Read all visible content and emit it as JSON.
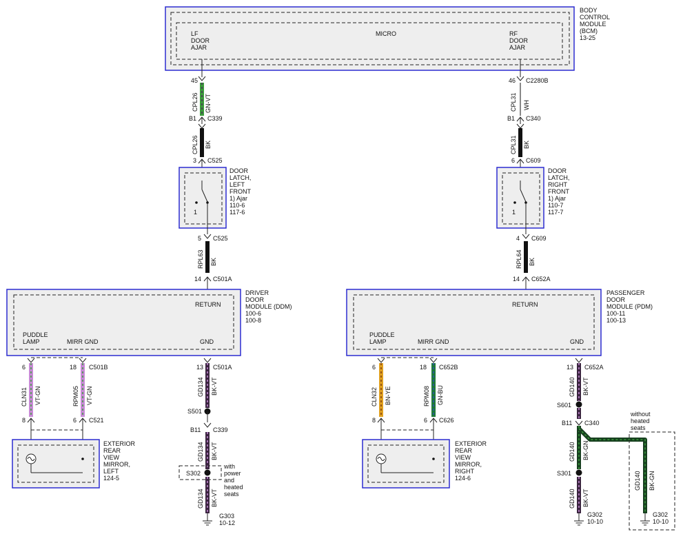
{
  "colors": {
    "box_border": "#2b2bd0",
    "GN-VT": "#3c9a3c",
    "VT-GN": "#c88bd6",
    "BK": "#111111",
    "WH": "#ffffff",
    "BK-VT": "#3b2540",
    "BN-YE": "#e0a020",
    "GN-BU": "#1f7a3a",
    "BK-GN": "#17401f"
  },
  "bcm": {
    "name_lines": [
      "BODY",
      "CONTROL",
      "MODULE",
      "(BCM)",
      "13-25"
    ],
    "micro": "MICRO",
    "lf_lines": [
      "LF",
      "DOOR",
      "AJAR"
    ],
    "rf_lines": [
      "RF",
      "DOOR",
      "AJAR"
    ]
  },
  "left": {
    "wire1": {
      "pin_top": "45",
      "circuit": "CPL26",
      "color": "GN-VT",
      "pin_bottom": "B1",
      "connector_bottom": "C339"
    },
    "wire2": {
      "circuit": "CPL26",
      "color": "BK",
      "pin_bottom": "3",
      "connector_bottom": "C525"
    },
    "latch": {
      "label_lines": [
        "DOOR",
        "LATCH,",
        "LEFT",
        "FRONT",
        "1) Ajar",
        "110-6",
        "117-6"
      ],
      "switch_num": "1"
    },
    "wire3": {
      "pin_top": "5",
      "connector_top": "C525",
      "circuit": "RPL63",
      "color": "BK",
      "pin_bottom": "14",
      "connector_bottom": "C501A"
    },
    "module": {
      "label_lines": [
        "DRIVER",
        "DOOR",
        "MODULE (DDM)",
        "100-6",
        "100-8"
      ],
      "return": "RETURN",
      "puddle_lines": [
        "PUDDLE",
        "LAMP"
      ],
      "mirr_gnd": "MIRR GND",
      "gnd": "GND"
    },
    "puddle_wire": {
      "pin_top": "6",
      "circuit": "CLN31",
      "color": "VT-GN",
      "pin_bottom": "8"
    },
    "mirr_wire": {
      "pin_top": "18",
      "connector_top": "C501B",
      "circuit": "RPM05",
      "color": "VT-GN",
      "pin_bottom": "6",
      "connector_bottom": "C521"
    },
    "mirror": {
      "label_lines": [
        "EXTERIOR",
        "REAR",
        "VIEW",
        "MIRROR,",
        "LEFT",
        "124-5"
      ]
    },
    "gnd_wire1": {
      "pin_top": "13",
      "connector_top": "C501A",
      "circuit": "GD134",
      "color": "BK-VT"
    },
    "splice1": "S501",
    "gnd_wire2": {
      "pin_top": "B11",
      "connector_top": "C339",
      "circuit": "GD134",
      "color": "BK-VT"
    },
    "splice2": "S302",
    "splice2_note_lines": [
      "with",
      "power",
      "and",
      "heated",
      "seats"
    ],
    "gnd_wire3": {
      "circuit": "GD134",
      "color": "BK-VT"
    },
    "ground": {
      "id": "G303",
      "ref": "10-12"
    }
  },
  "right": {
    "wire1": {
      "pin_top": "46",
      "connector_top": "C2280B",
      "circuit": "CPL31",
      "color": "WH",
      "pin_bottom": "B1",
      "connector_bottom": "C340"
    },
    "wire2": {
      "circuit": "CPL31",
      "color": "BK",
      "pin_bottom": "6",
      "connector_bottom": "C609"
    },
    "latch": {
      "label_lines": [
        "DOOR",
        "LATCH,",
        "RIGHT",
        "FRONT",
        "1) Ajar",
        "110-7",
        "117-7"
      ],
      "switch_num": "1"
    },
    "wire3": {
      "pin_top": "4",
      "connector_top": "C609",
      "circuit": "RPL64",
      "color": "BK",
      "pin_bottom": "14",
      "connector_bottom": "C652A"
    },
    "module": {
      "label_lines": [
        "PASSENGER",
        "DOOR",
        "MODULE (PDM)",
        "100-11",
        "100-13"
      ],
      "return": "RETURN",
      "puddle_lines": [
        "PUDDLE",
        "LAMP"
      ],
      "mirr_gnd": "MIRR GND",
      "gnd": "GND"
    },
    "puddle_wire": {
      "pin_top": "6",
      "circuit": "CLN32",
      "color": "BN-YE",
      "pin_bottom": "8"
    },
    "mirr_wire": {
      "pin_top": "18",
      "connector_top": "C652B",
      "circuit": "RPM08",
      "color": "GN-BU",
      "pin_bottom": "6",
      "connector_bottom": "C626"
    },
    "mirror": {
      "label_lines": [
        "EXTERIOR",
        "REAR",
        "VIEW",
        "MIRROR,",
        "RIGHT",
        "124-6"
      ]
    },
    "gnd_wire1": {
      "pin_top": "13",
      "connector_top": "C652A",
      "circuit": "GD140",
      "color": "BK-VT"
    },
    "splice1": "S601",
    "gnd_wire2": {
      "pin_top": "B11",
      "connector_top": "C340",
      "circuit": "GD140",
      "color": "BK-GN"
    },
    "splice2": "S301",
    "gnd_wire3": {
      "circuit": "GD140",
      "color": "BK-VT"
    },
    "ground": {
      "id": "G302",
      "ref": "10-10"
    },
    "branch_note_lines": [
      "without",
      "heated",
      "seats"
    ],
    "branch_wire": {
      "circuit": "GD140",
      "color": "BK-GN"
    },
    "ground2": {
      "id": "G302",
      "ref": "10-10"
    }
  }
}
